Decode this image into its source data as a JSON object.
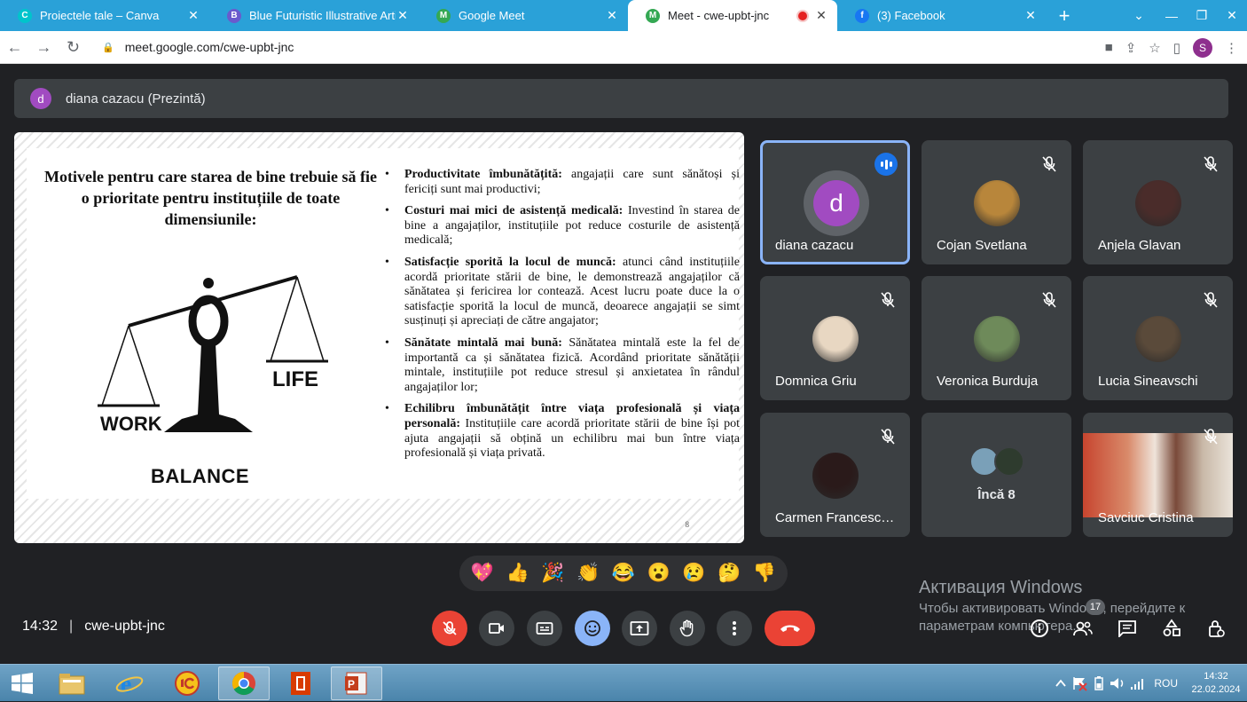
{
  "browser": {
    "tabs": [
      {
        "title": "Proiectele tale – Canva",
        "fav_color": "#00c4cc",
        "fav_letter": "C"
      },
      {
        "title": "Blue Futuristic Illustrative Artifi",
        "fav_color": "#6a5acd",
        "fav_letter": "B"
      },
      {
        "title": "Google Meet",
        "fav_color": "#34a853",
        "fav_letter": "M"
      },
      {
        "title": "Meet - cwe-upbt-jnc",
        "fav_color": "#34a853",
        "fav_letter": "M",
        "active": true,
        "recording": true
      },
      {
        "title": "(3) Facebook",
        "fav_color": "#1877f2",
        "fav_letter": "f"
      }
    ],
    "url": "meet.google.com/cwe-upbt-jnc",
    "profile_initial": "S"
  },
  "presenter_bar": {
    "avatar_initial": "d",
    "label": "diana cazacu (Prezintă)"
  },
  "slide": {
    "title": "Motivele pentru care starea de bine trebuie să fie o prioritate pentru instituțiile de toate dimensiunile:",
    "image_words": {
      "work": "WORK",
      "life": "LIFE",
      "balance": "BALANCE"
    },
    "bullets": [
      {
        "bold": "Productivitate îmbunătățită:",
        "text": " angajații care sunt sănătoși și fericiți sunt mai productivi;"
      },
      {
        "bold": "Costuri mai mici de asistență medicală:",
        "text": " Investind în starea de bine a angajaților, instituțiile pot reduce costurile de asistență medicală;"
      },
      {
        "bold": "Satisfacție sporită la locul de muncă:",
        "text": " atunci când instituțiile acordă prioritate stării de bine, le demonstrează angajaților că sănătatea și fericirea lor contează. Acest lucru poate duce la o satisfacție sporită la locul de muncă, deoarece angajații se simt susținuți și apreciați de către angajator;"
      },
      {
        "bold": "Sănătate mintală mai bună:",
        "text": " Sănătatea mintală este la fel de importantă ca și sănătatea fizică. Acordând prioritate sănătății mintale, instituțiile pot reduce stresul și anxietatea în rândul angajaților lor;"
      },
      {
        "bold": "Echilibru îmbunătățit între viața profesională și viața personală:",
        "text": " Instituțiile care acordă prioritate stării de bine își pot ajuta angajații să obțină un echilibru mai bun între viața profesională și viața privată."
      }
    ],
    "page_number": "8"
  },
  "participants": [
    {
      "name": "diana cazacu",
      "initial": "d",
      "speaking": true
    },
    {
      "name": "Cojan Svetlana",
      "muted": true,
      "photo_color": "#b8863b"
    },
    {
      "name": "Anjela Glavan",
      "muted": true,
      "photo_color": "#4a2c2a"
    },
    {
      "name": "Domnica Griu",
      "muted": true,
      "photo_color": "#e8d7c2"
    },
    {
      "name": "Veronica Burduja",
      "muted": true,
      "photo_color": "#6e8a5a"
    },
    {
      "name": "Lucia Sineavschi",
      "muted": true,
      "photo_color": "#5a4a3a"
    },
    {
      "name": "Carmen Francesc…",
      "muted": true,
      "photo_color": "#2a1a1a"
    },
    {
      "name": "Încă 8",
      "more": true
    },
    {
      "name": "Savciuc Cristina",
      "muted": true,
      "video": true
    }
  ],
  "reactions": [
    "💖",
    "👍",
    "🎉",
    "👏",
    "😂",
    "😮",
    "😢",
    "🤔",
    "👎"
  ],
  "meeting": {
    "time": "14:32",
    "code": "cwe-upbt-jnc",
    "participant_count": "17"
  },
  "windows_activation": {
    "title": "Активация Windows",
    "line1": "Чтобы активировать Windows, перейдите к",
    "line2": "параметрам компьютера."
  },
  "taskbar": {
    "lang": "ROU",
    "time": "14:32",
    "date": "22.02.2024"
  }
}
